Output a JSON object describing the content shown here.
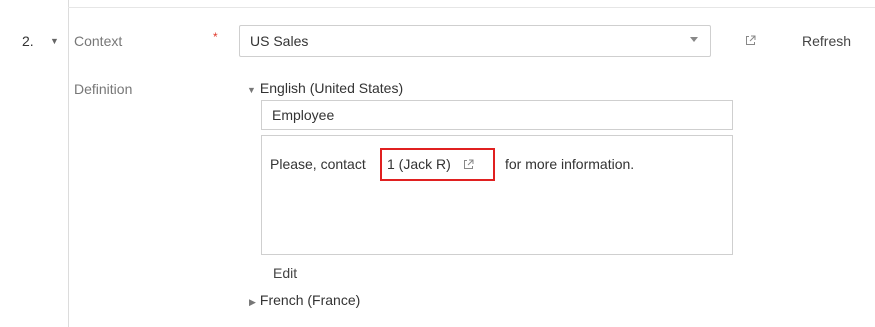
{
  "row": {
    "number": "2."
  },
  "context": {
    "label": "Context",
    "required_mark": "*",
    "selected": "US Sales",
    "refresh_label": "Refresh"
  },
  "definition": {
    "label": "Definition",
    "languages": [
      {
        "name": "English (United States)",
        "expanded": true,
        "term": "Employee",
        "text_before": "Please, contact",
        "link_text": "1 (Jack R)",
        "text_after": "for more information.",
        "edit_label": "Edit"
      },
      {
        "name": "French (France)",
        "expanded": false
      }
    ]
  },
  "colors": {
    "required": "#e0392b",
    "highlight": "#e02020",
    "label": "#777777"
  }
}
